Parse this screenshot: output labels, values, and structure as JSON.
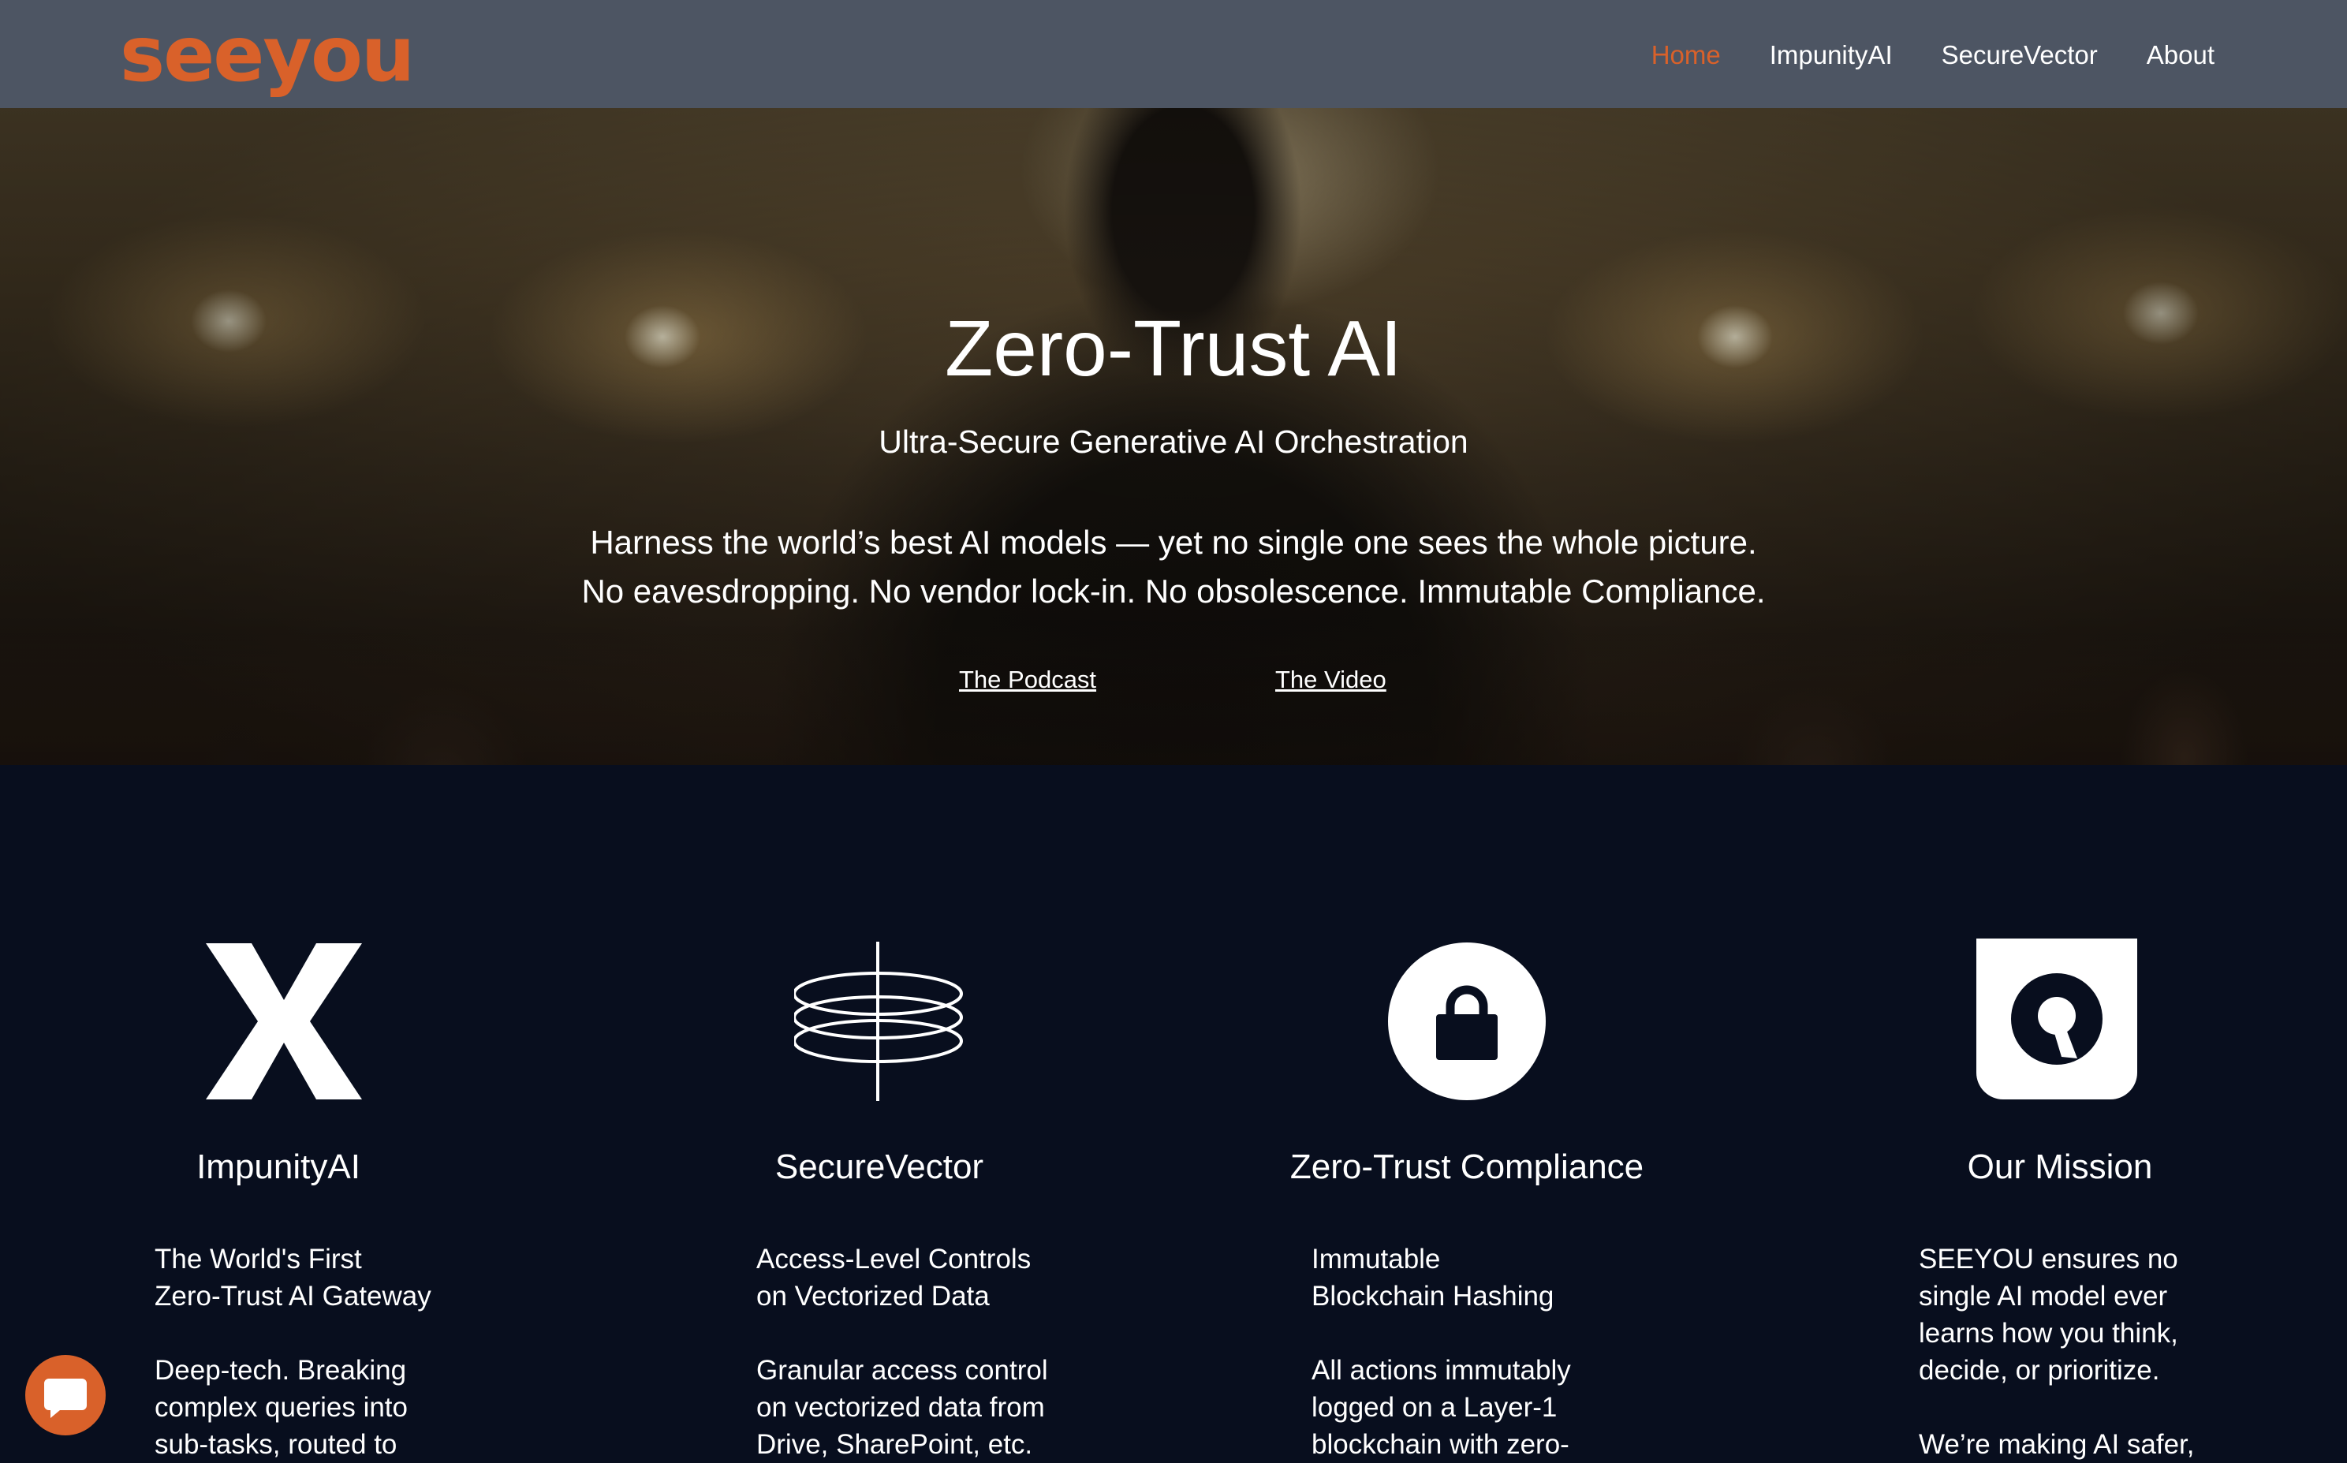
{
  "header": {
    "logo": "seeyou",
    "nav": [
      {
        "label": "Home",
        "active": true
      },
      {
        "label": "ImpunityAI",
        "active": false
      },
      {
        "label": "SecureVector",
        "active": false
      },
      {
        "label": "About",
        "active": false
      }
    ]
  },
  "hero": {
    "title": "Zero-Trust AI",
    "subtitle": "Ultra-Secure Generative AI Orchestration",
    "line1": "Harness the world’s best AI models — yet no single one sees the whole picture.",
    "line2": "No eavesdropping. No vendor lock-in. No obsolescence. Immutable Compliance.",
    "podcast_link": "The Podcast",
    "video_link": "The Video"
  },
  "features": [
    {
      "icon": "x-icon",
      "title": "ImpunityAI",
      "body": [
        "The World's First",
        "Zero-Trust AI Gateway",
        "",
        "Deep-tech. Breaking",
        "complex queries into",
        "sub-tasks, routed to"
      ]
    },
    {
      "icon": "vector-stack-icon",
      "title": "SecureVector",
      "body": [
        "Access-Level Controls",
        "on Vectorized Data",
        "",
        "Granular access control",
        "on vectorized data from",
        "Drive, SharePoint, etc."
      ]
    },
    {
      "icon": "lock-icon",
      "title": "Zero-Trust Compliance",
      "body": [
        "Immutable",
        "Blockchain Hashing",
        "",
        "All actions immutably",
        "logged on a Layer-1",
        "blockchain with zero-"
      ]
    },
    {
      "icon": "mission-icon",
      "title": "Our Mission",
      "body": [
        "SEEYOU ensures no",
        "single AI model ever",
        "learns how you think,",
        "decide, or prioritize.",
        "",
        "We’re making AI safer,"
      ]
    }
  ],
  "colors": {
    "brand": "#d9612a",
    "header_bg": "#4d5563",
    "page_bg": "#080e1e"
  },
  "chat": {
    "icon": "chat-icon"
  }
}
